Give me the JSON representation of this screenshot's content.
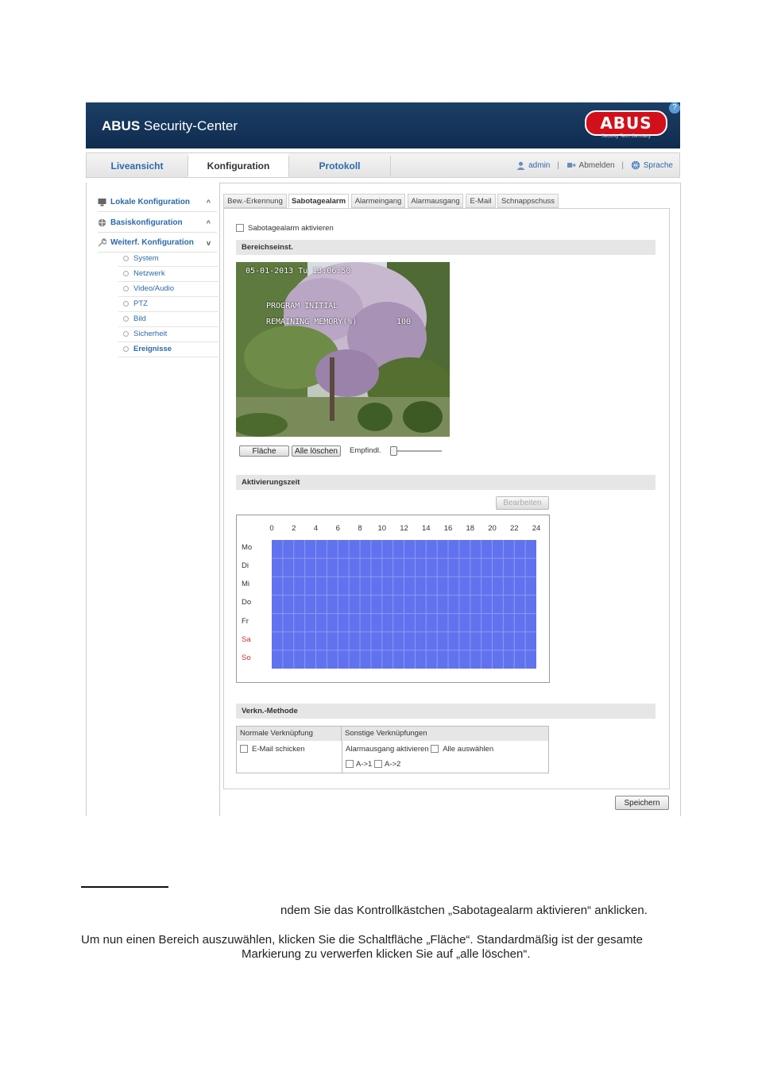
{
  "header": {
    "title_bold": "ABUS",
    "title_rest": " Security-Center",
    "logo_text": "ABUS",
    "logo_subtitle": "Security Tech Germany",
    "help_label": "?"
  },
  "navbar": {
    "tabs": [
      {
        "label": "Liveansicht"
      },
      {
        "label": "Konfiguration"
      },
      {
        "label": "Protokoll"
      }
    ],
    "user": "admin",
    "logout": "Abmelden",
    "language": "Sprache"
  },
  "sidebar": {
    "sections": [
      {
        "label": "Lokale Konfiguration",
        "chevron": "^"
      },
      {
        "label": "Basiskonfiguration",
        "chevron": "^"
      },
      {
        "label": "Weiterf. Konfiguration",
        "chevron": "v"
      }
    ],
    "items": [
      {
        "label": "System"
      },
      {
        "label": "Netzwerk"
      },
      {
        "label": "Video/Audio"
      },
      {
        "label": "PTZ"
      },
      {
        "label": "Bild"
      },
      {
        "label": "Sicherheit"
      },
      {
        "label": "Ereignisse"
      }
    ]
  },
  "subtabs": [
    {
      "label": "Bew.-Erkennung"
    },
    {
      "label": "Sabotagealarm"
    },
    {
      "label": "Alarmeingang"
    },
    {
      "label": "Alarmausgang"
    },
    {
      "label": "E-Mail"
    },
    {
      "label": "Schnappschuss"
    }
  ],
  "tamper": {
    "enable_label": "Sabotagealarm aktivieren",
    "area_section": "Bereichseinst.",
    "osd_datetime": "05-01-2013 Tu 13:06:50",
    "osd_line1": "PROGRAM INITIAL",
    "osd_line2": "REMAINING MEMORY(%)",
    "osd_value": "100",
    "btn_area": "Fläche",
    "btn_clear": "Alle löschen",
    "sensitivity_label": "Empfindl."
  },
  "schedule": {
    "section": "Aktivierungszeit",
    "edit_button": "Bearbeiten",
    "hours": [
      "0",
      "2",
      "4",
      "6",
      "8",
      "10",
      "12",
      "14",
      "16",
      "18",
      "20",
      "22",
      "24"
    ],
    "days": [
      "Mo",
      "Di",
      "Mi",
      "Do",
      "Fr",
      "Sa",
      "So"
    ],
    "weekend_color": "#d03030",
    "active_color": "#6172ee"
  },
  "linkage": {
    "section": "Verkn.-Methode",
    "col1_header": "Normale Verknüpfung",
    "col2_header": "Sonstige Verknüpfungen",
    "email_label": "E-Mail schicken",
    "alarm_output_label": "Alarmausgang aktivieren",
    "select_all_label": "Alle auswählen",
    "out1_label": "A->1",
    "out2_label": "A->2"
  },
  "save_button": "Speichern",
  "body_text": {
    "line1": "ndem Sie das Kontrollkästchen „Sabotagealarm aktivieren“ anklicken.",
    "line2": "Um nun einen Bereich auszuwählen, klicken Sie die Schaltfläche „Fläche“. Standardmäßig ist der gesamte",
    "line3": "Markierung zu verwerfen klicken Sie auf „alle löschen“."
  }
}
